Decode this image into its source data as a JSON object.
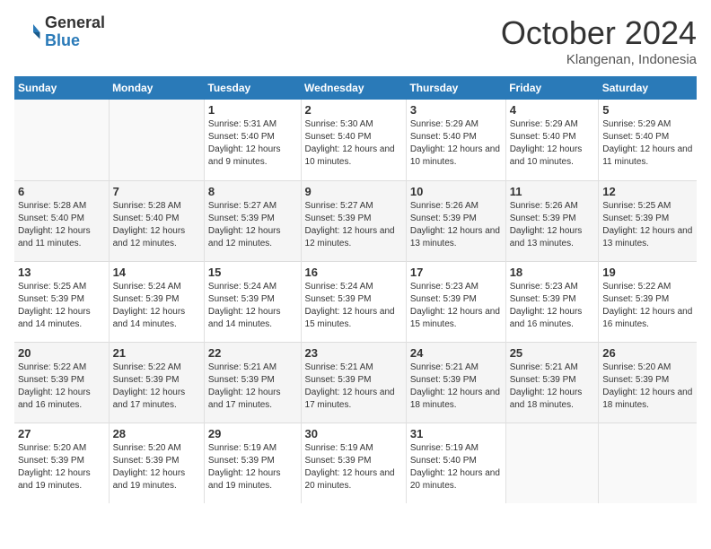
{
  "logo": {
    "text_general": "General",
    "text_blue": "Blue"
  },
  "header": {
    "month": "October 2024",
    "location": "Klangenan, Indonesia"
  },
  "days_of_week": [
    "Sunday",
    "Monday",
    "Tuesday",
    "Wednesday",
    "Thursday",
    "Friday",
    "Saturday"
  ],
  "weeks": [
    [
      {
        "day": "",
        "info": ""
      },
      {
        "day": "",
        "info": ""
      },
      {
        "day": "1",
        "sunrise": "Sunrise: 5:31 AM",
        "sunset": "Sunset: 5:40 PM",
        "daylight": "Daylight: 12 hours and 9 minutes."
      },
      {
        "day": "2",
        "sunrise": "Sunrise: 5:30 AM",
        "sunset": "Sunset: 5:40 PM",
        "daylight": "Daylight: 12 hours and 10 minutes."
      },
      {
        "day": "3",
        "sunrise": "Sunrise: 5:29 AM",
        "sunset": "Sunset: 5:40 PM",
        "daylight": "Daylight: 12 hours and 10 minutes."
      },
      {
        "day": "4",
        "sunrise": "Sunrise: 5:29 AM",
        "sunset": "Sunset: 5:40 PM",
        "daylight": "Daylight: 12 hours and 10 minutes."
      },
      {
        "day": "5",
        "sunrise": "Sunrise: 5:29 AM",
        "sunset": "Sunset: 5:40 PM",
        "daylight": "Daylight: 12 hours and 11 minutes."
      }
    ],
    [
      {
        "day": "6",
        "sunrise": "Sunrise: 5:28 AM",
        "sunset": "Sunset: 5:40 PM",
        "daylight": "Daylight: 12 hours and 11 minutes."
      },
      {
        "day": "7",
        "sunrise": "Sunrise: 5:28 AM",
        "sunset": "Sunset: 5:40 PM",
        "daylight": "Daylight: 12 hours and 12 minutes."
      },
      {
        "day": "8",
        "sunrise": "Sunrise: 5:27 AM",
        "sunset": "Sunset: 5:39 PM",
        "daylight": "Daylight: 12 hours and 12 minutes."
      },
      {
        "day": "9",
        "sunrise": "Sunrise: 5:27 AM",
        "sunset": "Sunset: 5:39 PM",
        "daylight": "Daylight: 12 hours and 12 minutes."
      },
      {
        "day": "10",
        "sunrise": "Sunrise: 5:26 AM",
        "sunset": "Sunset: 5:39 PM",
        "daylight": "Daylight: 12 hours and 13 minutes."
      },
      {
        "day": "11",
        "sunrise": "Sunrise: 5:26 AM",
        "sunset": "Sunset: 5:39 PM",
        "daylight": "Daylight: 12 hours and 13 minutes."
      },
      {
        "day": "12",
        "sunrise": "Sunrise: 5:25 AM",
        "sunset": "Sunset: 5:39 PM",
        "daylight": "Daylight: 12 hours and 13 minutes."
      }
    ],
    [
      {
        "day": "13",
        "sunrise": "Sunrise: 5:25 AM",
        "sunset": "Sunset: 5:39 PM",
        "daylight": "Daylight: 12 hours and 14 minutes."
      },
      {
        "day": "14",
        "sunrise": "Sunrise: 5:24 AM",
        "sunset": "Sunset: 5:39 PM",
        "daylight": "Daylight: 12 hours and 14 minutes."
      },
      {
        "day": "15",
        "sunrise": "Sunrise: 5:24 AM",
        "sunset": "Sunset: 5:39 PM",
        "daylight": "Daylight: 12 hours and 14 minutes."
      },
      {
        "day": "16",
        "sunrise": "Sunrise: 5:24 AM",
        "sunset": "Sunset: 5:39 PM",
        "daylight": "Daylight: 12 hours and 15 minutes."
      },
      {
        "day": "17",
        "sunrise": "Sunrise: 5:23 AM",
        "sunset": "Sunset: 5:39 PM",
        "daylight": "Daylight: 12 hours and 15 minutes."
      },
      {
        "day": "18",
        "sunrise": "Sunrise: 5:23 AM",
        "sunset": "Sunset: 5:39 PM",
        "daylight": "Daylight: 12 hours and 16 minutes."
      },
      {
        "day": "19",
        "sunrise": "Sunrise: 5:22 AM",
        "sunset": "Sunset: 5:39 PM",
        "daylight": "Daylight: 12 hours and 16 minutes."
      }
    ],
    [
      {
        "day": "20",
        "sunrise": "Sunrise: 5:22 AM",
        "sunset": "Sunset: 5:39 PM",
        "daylight": "Daylight: 12 hours and 16 minutes."
      },
      {
        "day": "21",
        "sunrise": "Sunrise: 5:22 AM",
        "sunset": "Sunset: 5:39 PM",
        "daylight": "Daylight: 12 hours and 17 minutes."
      },
      {
        "day": "22",
        "sunrise": "Sunrise: 5:21 AM",
        "sunset": "Sunset: 5:39 PM",
        "daylight": "Daylight: 12 hours and 17 minutes."
      },
      {
        "day": "23",
        "sunrise": "Sunrise: 5:21 AM",
        "sunset": "Sunset: 5:39 PM",
        "daylight": "Daylight: 12 hours and 17 minutes."
      },
      {
        "day": "24",
        "sunrise": "Sunrise: 5:21 AM",
        "sunset": "Sunset: 5:39 PM",
        "daylight": "Daylight: 12 hours and 18 minutes."
      },
      {
        "day": "25",
        "sunrise": "Sunrise: 5:21 AM",
        "sunset": "Sunset: 5:39 PM",
        "daylight": "Daylight: 12 hours and 18 minutes."
      },
      {
        "day": "26",
        "sunrise": "Sunrise: 5:20 AM",
        "sunset": "Sunset: 5:39 PM",
        "daylight": "Daylight: 12 hours and 18 minutes."
      }
    ],
    [
      {
        "day": "27",
        "sunrise": "Sunrise: 5:20 AM",
        "sunset": "Sunset: 5:39 PM",
        "daylight": "Daylight: 12 hours and 19 minutes."
      },
      {
        "day": "28",
        "sunrise": "Sunrise: 5:20 AM",
        "sunset": "Sunset: 5:39 PM",
        "daylight": "Daylight: 12 hours and 19 minutes."
      },
      {
        "day": "29",
        "sunrise": "Sunrise: 5:19 AM",
        "sunset": "Sunset: 5:39 PM",
        "daylight": "Daylight: 12 hours and 19 minutes."
      },
      {
        "day": "30",
        "sunrise": "Sunrise: 5:19 AM",
        "sunset": "Sunset: 5:39 PM",
        "daylight": "Daylight: 12 hours and 20 minutes."
      },
      {
        "day": "31",
        "sunrise": "Sunrise: 5:19 AM",
        "sunset": "Sunset: 5:40 PM",
        "daylight": "Daylight: 12 hours and 20 minutes."
      },
      {
        "day": "",
        "info": ""
      },
      {
        "day": "",
        "info": ""
      }
    ]
  ]
}
